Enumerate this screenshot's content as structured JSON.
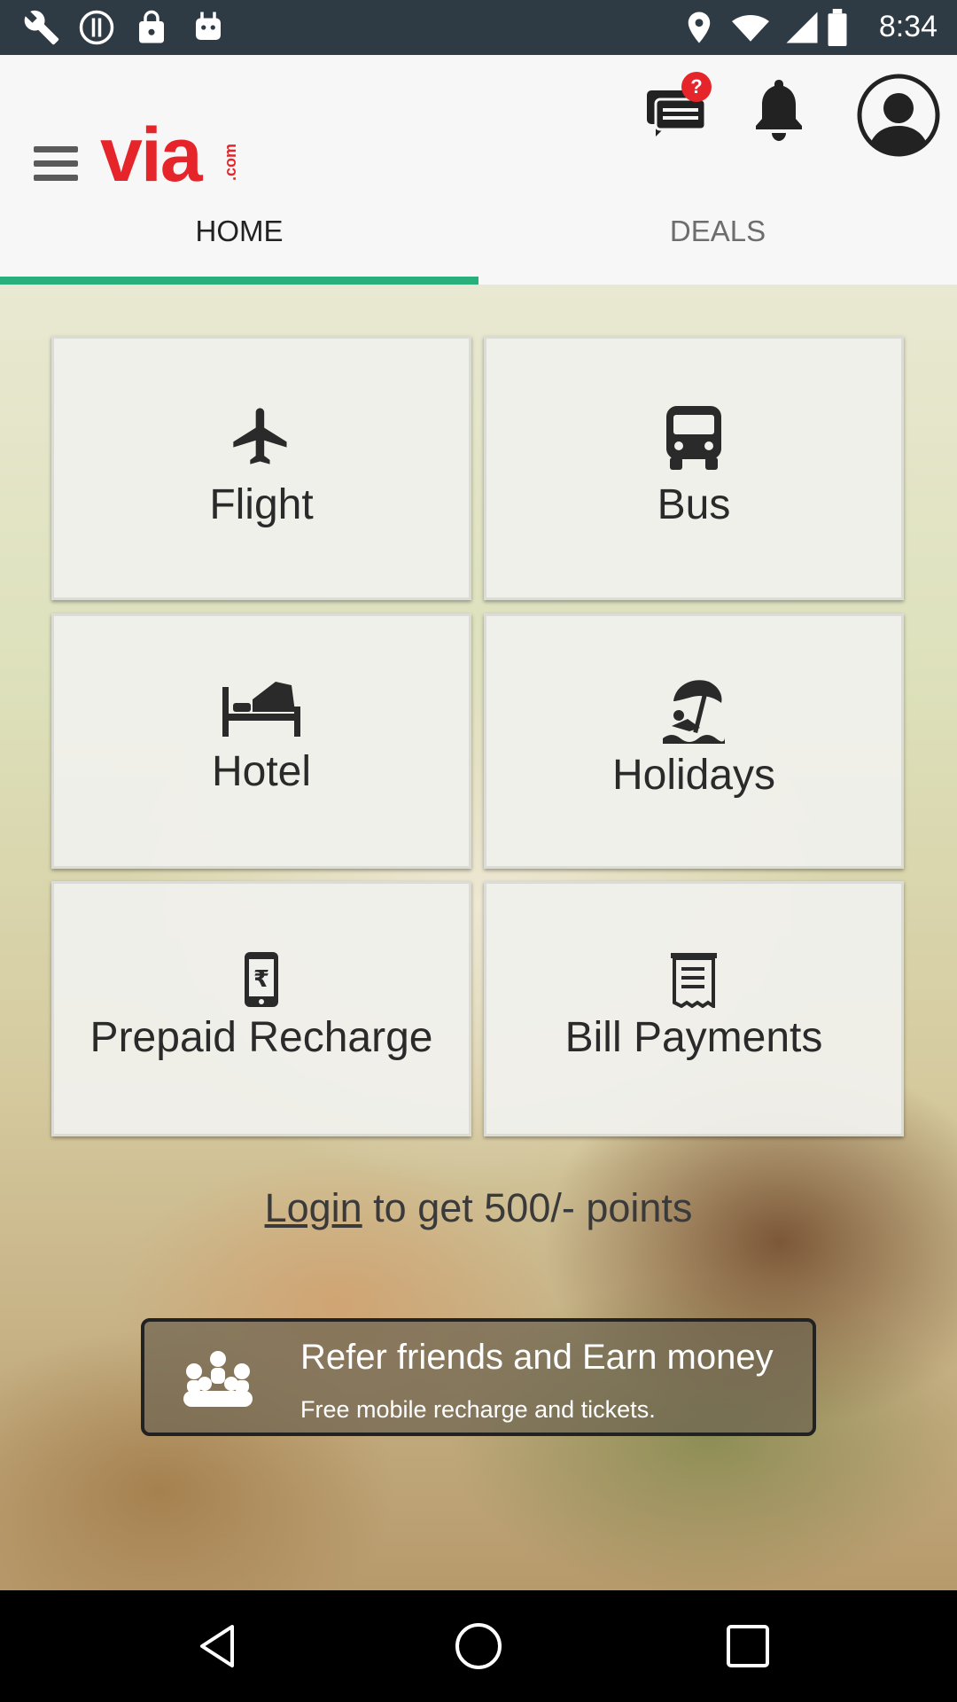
{
  "status_bar": {
    "time": "8:34",
    "icons": [
      "wrench-icon",
      "sync-icon",
      "lock-icon",
      "android-icon",
      "location-icon",
      "wifi-icon",
      "cell-signal-icon",
      "battery-icon"
    ]
  },
  "header": {
    "logo_text": "via",
    "logo_suffix": ".com",
    "chat_badge": "?"
  },
  "tabs": [
    {
      "label": "HOME",
      "active": true
    },
    {
      "label": "DEALS",
      "active": false
    }
  ],
  "services": [
    {
      "label": "Flight",
      "icon": "airplane-icon"
    },
    {
      "label": "Bus",
      "icon": "bus-icon"
    },
    {
      "label": "Hotel",
      "icon": "bed-icon"
    },
    {
      "label": "Holidays",
      "icon": "beach-icon"
    },
    {
      "label": "Prepaid Recharge",
      "icon": "mobile-rupee-icon"
    },
    {
      "label": "Bill Payments",
      "icon": "receipt-icon"
    }
  ],
  "login_promo": {
    "link": "Login",
    "rest": " to get 500/- points"
  },
  "refer": {
    "title": "Refer friends and Earn money",
    "subtitle": "Free mobile recharge and tickets."
  },
  "colors": {
    "brand_red": "#e5252a",
    "tab_indicator": "#27b07c",
    "status_bar": "#2e3a44"
  }
}
